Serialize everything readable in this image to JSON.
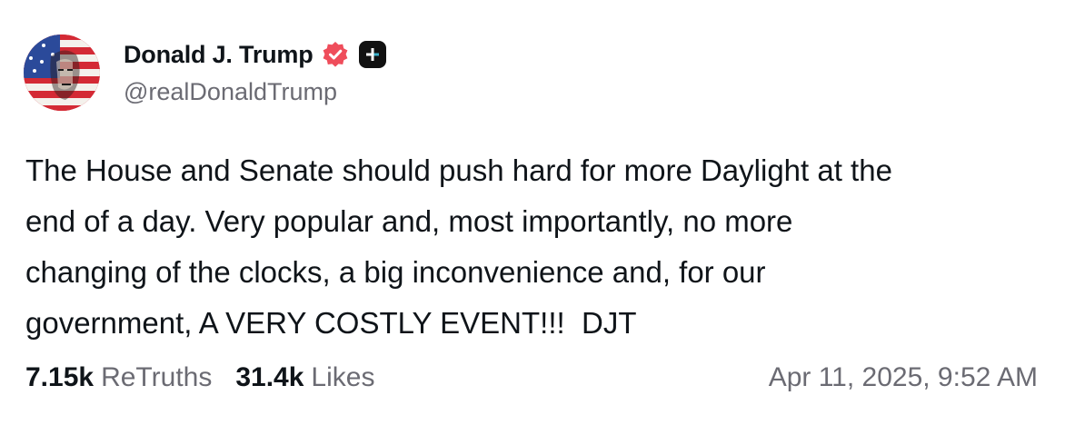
{
  "user": {
    "display_name": "Donald J. Trump",
    "handle": "@realDonaldTrump",
    "verified_icon": "verified-badge-icon",
    "extra_badge_icon": "truth-plus-icon",
    "badge_color": "#ef4d5b"
  },
  "post": {
    "text": "The House and Senate should push hard for more Daylight at the\nend of a day. Very popular and, most importantly, no more\nchanging of the clocks, a big inconvenience and, for our\ngovernment, A VERY COSTLY EVENT!!!  DJT"
  },
  "stats": {
    "retruths_count": "7.15k",
    "retruths_label": "ReTruths",
    "likes_count": "31.4k",
    "likes_label": "Likes"
  },
  "timestamp": "Apr 11, 2025, 9:52 AM"
}
